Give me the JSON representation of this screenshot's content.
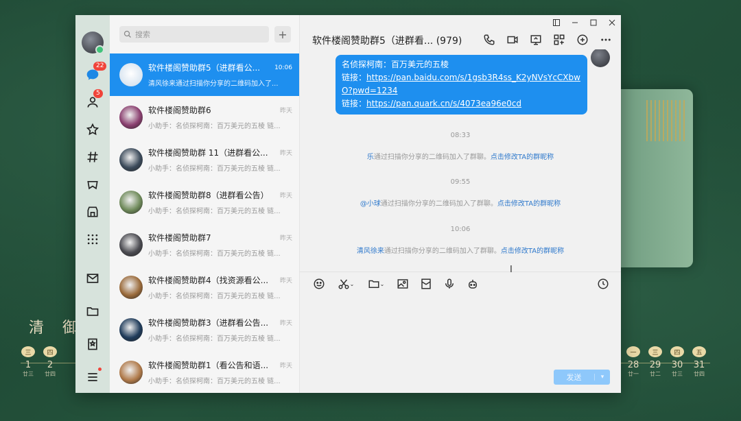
{
  "wallpaper": {
    "title": "清 御",
    "calendar_left": [
      {
        "dot": "三",
        "day": "1",
        "lunar": "廿三"
      },
      {
        "dot": "四",
        "day": "2",
        "lunar": "廿四"
      }
    ],
    "calendar_right": [
      {
        "dot": "一",
        "day": "28",
        "lunar": "廿一"
      },
      {
        "dot": "三",
        "day": "29",
        "lunar": "廿二"
      },
      {
        "dot": "四",
        "day": "30",
        "lunar": "廿三"
      },
      {
        "dot": "五",
        "day": "31",
        "lunar": "廿四"
      }
    ]
  },
  "nav": {
    "messages_badge": "22",
    "contacts_badge": "5"
  },
  "list": {
    "search_placeholder": "搜索",
    "plus": "+",
    "conversations": [
      {
        "name": "软件楼阁赞助群5（进群看公...",
        "time": "10:06",
        "msg": "清风徐来通过扫描你分享的二维码加入了...",
        "active": true,
        "avatar_color": "#dfe9f3"
      },
      {
        "name": "软件楼阁赞助群6",
        "time": "昨天",
        "msg": "小助手：名侦探柯南：百万美元的五棱 链...",
        "avatar_color": "#8a3f6f"
      },
      {
        "name": "软件楼阁赞助群 11（进群看公...",
        "time": "昨天",
        "msg": "小助手：名侦探柯南：百万美元的五棱 链...",
        "avatar_color": "#3b4a5a"
      },
      {
        "name": "软件楼阁赞助群8（进群看公告）",
        "time": "昨天",
        "msg": "小助手：名侦探柯南：百万美元的五棱 链...",
        "avatar_color": "#6f8a5a"
      },
      {
        "name": "软件楼阁赞助群7",
        "time": "昨天",
        "msg": "小助手：名侦探柯南：百万美元的五棱 链...",
        "avatar_color": "#4a4a50"
      },
      {
        "name": "软件楼阁赞助群4（找资源看公...",
        "time": "昨天",
        "msg": "小助手：名侦探柯南：百万美元的五棱 链...",
        "avatar_color": "#9a6a3a"
      },
      {
        "name": "软件楼阁赞助群3（进群看公告...",
        "time": "昨天",
        "msg": "小助手：名侦探柯南：百万美元的五棱 链...",
        "avatar_color": "#1f3b5a"
      },
      {
        "name": "软件楼阁赞助群1（看公告和语...",
        "time": "昨天",
        "msg": "小助手：名侦探柯南：百万美元的五棱 链...",
        "avatar_color": "#b07a4a"
      }
    ]
  },
  "chat": {
    "title": "软件楼阁赞助群5（进群看...  (979)",
    "bubble": {
      "line1": "名侦探柯南：百万美元的五棱",
      "line2_label": "链接：",
      "line2_link": "https://pan.baidu.com/s/1gsb3R4ss_K2yNVsYcCXbwO?pwd=1234",
      "line3_label": "链接：",
      "line3_link": "https://pan.quark.cn/s/4073ea96e0cd"
    },
    "events": [
      {
        "time": "08:33",
        "who": "乐",
        "text": "通过扫描你分享的二维码加入了群聊。",
        "action": "点击修改TA的群昵称"
      },
      {
        "time": "09:55",
        "who": "@小球",
        "text": "通过扫描你分享的二维码加入了群聊。",
        "action": "点击修改TA的群昵称"
      },
      {
        "time": "10:06",
        "who": "清风徐来",
        "text": "通过扫描你分享的二维码加入了群聊。",
        "action": "点击修改TA的群昵称"
      }
    ],
    "send_label": "发送"
  },
  "colors": {
    "accent": "#1e8fef",
    "link": "#2f79cc",
    "badge": "#f0443a",
    "nav_bg": "#d7e3dc"
  }
}
